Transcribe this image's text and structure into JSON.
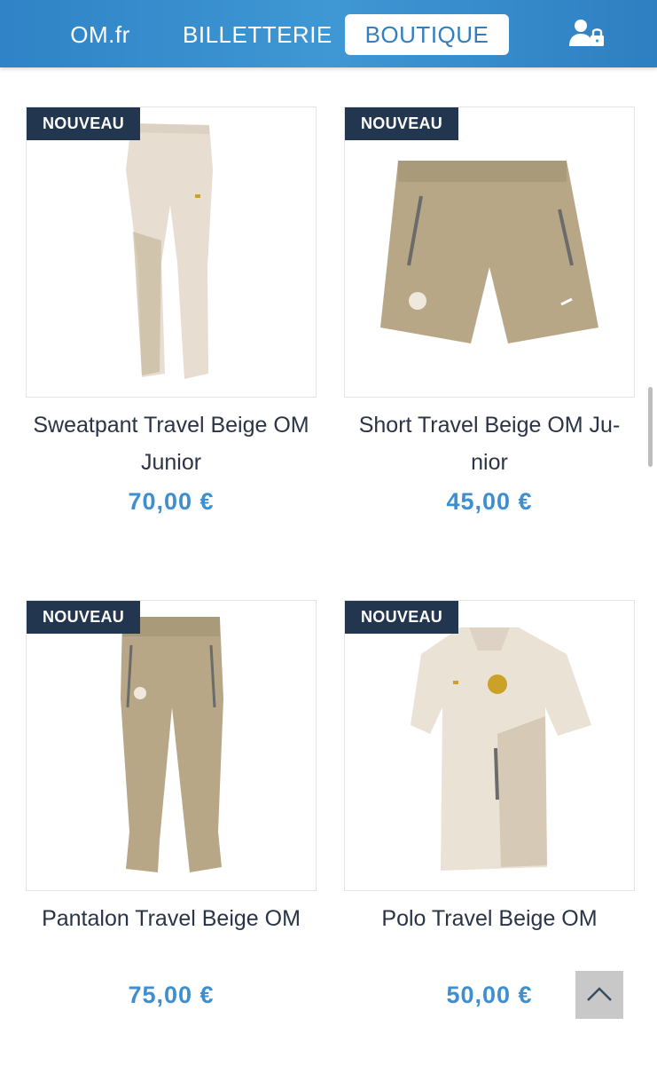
{
  "nav": {
    "om_label": "OM.fr",
    "billetterie_label": "BILLETTERIE",
    "boutique_label": "BOUTIQUE"
  },
  "products": [
    {
      "badge": "NOUVEAU",
      "name_line1": "Sweatpant Travel Beige OM",
      "name_line2": "Junior",
      "price": "70,00 €"
    },
    {
      "badge": "NOUVEAU",
      "name_line1": "Short Travel Beige OM Ju-",
      "name_line2": "nior",
      "price": "45,00 €"
    },
    {
      "badge": "NOUVEAU",
      "name_line1": "Pantalon Travel Beige OM",
      "name_line2": "",
      "price": "75,00 €"
    },
    {
      "badge": "NOUVEAU",
      "name_line1": "Polo Travel Beige OM",
      "name_line2": "",
      "price": "50,00 €"
    }
  ],
  "colors": {
    "nav_blue": "#3f97d3",
    "badge_navy": "#23364f",
    "price_blue": "#3e8fd0"
  },
  "icons": {
    "account": "user-lock-icon",
    "back_to_top": "chevron-up-icon"
  }
}
